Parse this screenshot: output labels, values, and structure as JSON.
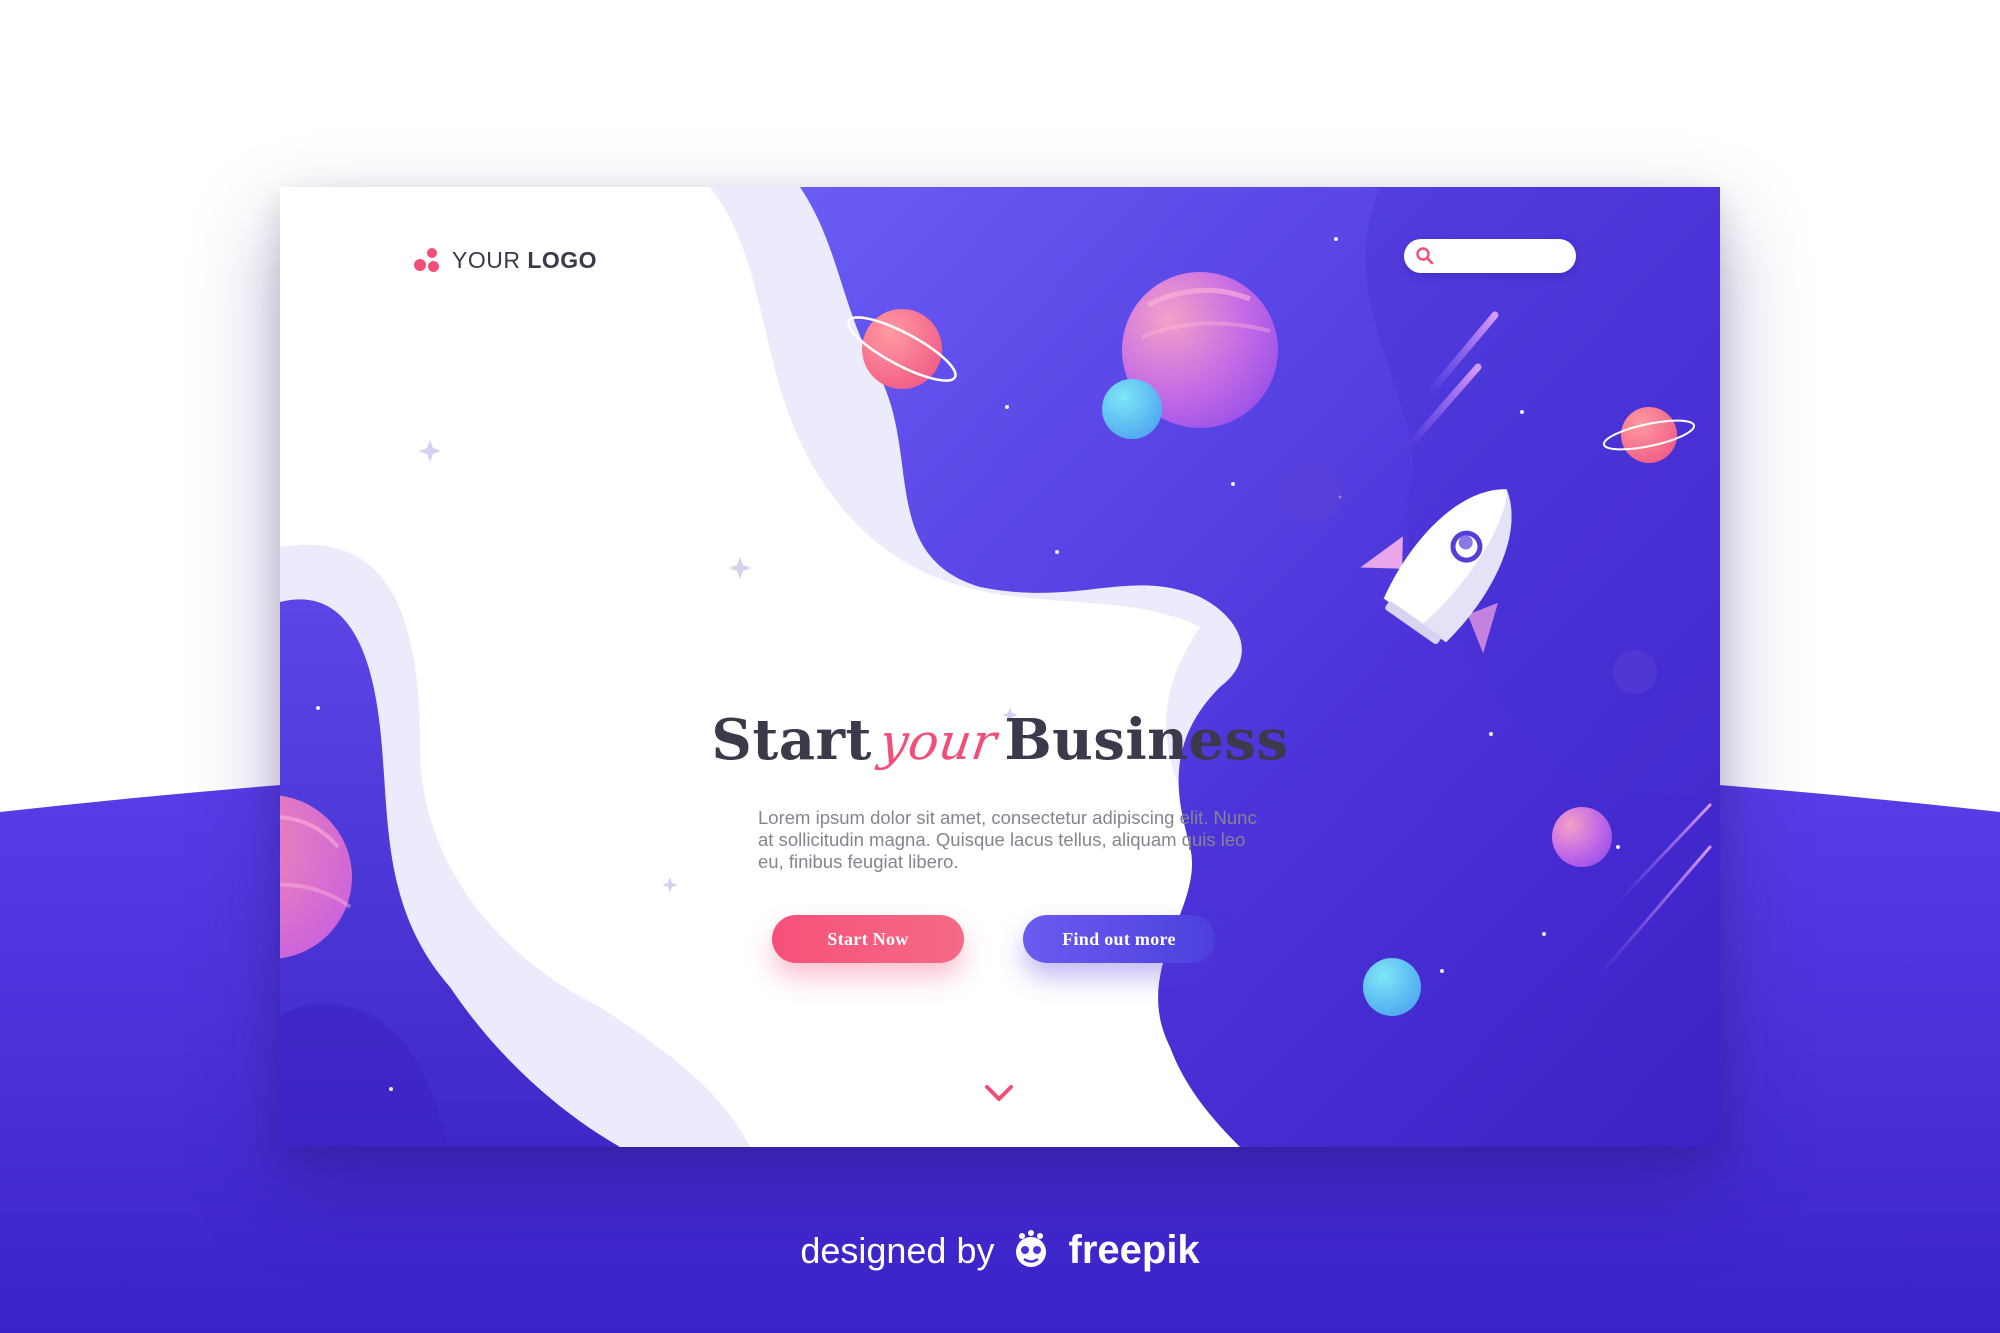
{
  "colors": {
    "primary_purple": "#4a33d6",
    "accent_pink": "#f14e78",
    "white": "#ffffff",
    "text_dark": "#3b3a4a",
    "text_muted": "#858590"
  },
  "header": {
    "logo_icon": "logo-dots-icon",
    "logo_text_light": "YOUR",
    "logo_text_bold": "LOGO",
    "search_icon": "search-icon",
    "search_value": ""
  },
  "hero": {
    "title_start": "Start",
    "title_your": "your",
    "title_end": "Business",
    "description": "Lorem ipsum dolor sit amet, consectetur adipiscing elit. Nunc at sollicitudin magna. Quisque lacus tellus, aliquam quis leo eu, finibus feugiat libero.",
    "primary_button": "Start Now",
    "secondary_button": "Find out more",
    "scroll_icon": "chevron-down-icon"
  },
  "illustration": {
    "items": [
      "rocket-icon",
      "planet-pink-ringed-icon",
      "planet-purple-large-icon",
      "planet-blue-small-icon",
      "star-icon"
    ]
  },
  "credit": {
    "prefix": "designed by",
    "brand": "freepik",
    "brand_icon": "freepik-mascot-icon"
  }
}
